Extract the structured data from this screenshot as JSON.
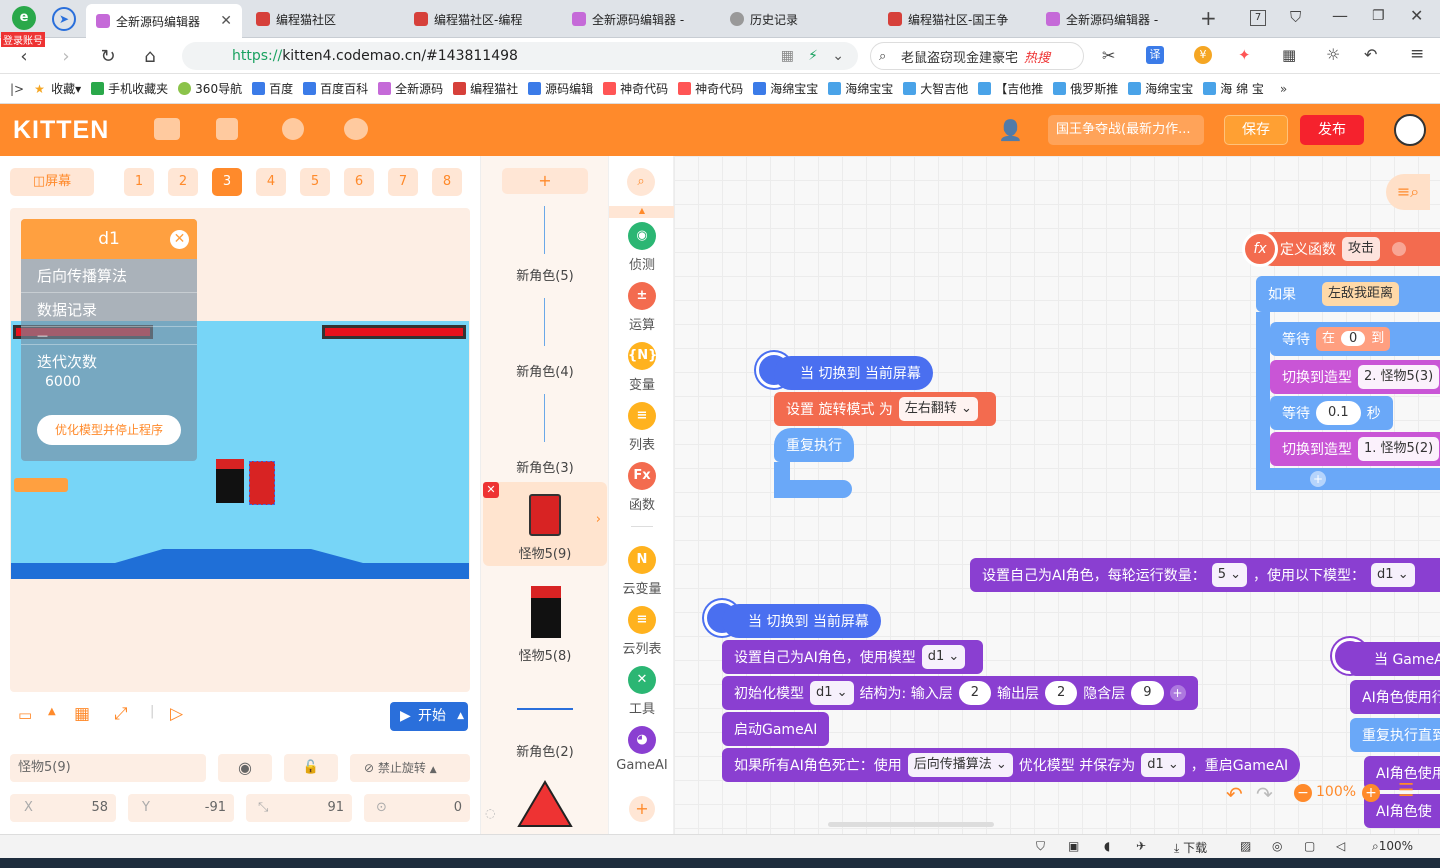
{
  "browser": {
    "login_badge": "登录账号",
    "tabs": [
      {
        "title": "全新源码编辑器",
        "active": true
      },
      {
        "title": "编程猫社区"
      },
      {
        "title": "编程猫社区-编程"
      },
      {
        "title": "全新源码编辑器 -"
      },
      {
        "title": "历史记录"
      },
      {
        "title": "编程猫社区-国王争"
      },
      {
        "title": "全新源码编辑器 -"
      }
    ],
    "url_prefix": "https://",
    "url_rest": "kitten4.codemao.cn/#143811498",
    "search_text": "老鼠盗窃现金建豪宅",
    "search_hot": "热搜",
    "bookmarks": [
      "收藏",
      "手机收藏夹",
      "360导航",
      "百度",
      "百度百科",
      "全新源码",
      "编程猫社",
      "源码编辑",
      "神奇代码",
      "神奇代码",
      "海绵宝宝",
      "海绵宝宝",
      "大智吉他",
      "【吉他推",
      "俄罗斯推",
      "海绵宝宝",
      "海 绵 宝"
    ]
  },
  "kitten": {
    "logo": "KITTEN",
    "project_name": "国王争夺战(最新力作...",
    "save_label": "保存",
    "publish_label": "发布"
  },
  "screens": {
    "screen_label": "屏幕",
    "tabs": [
      "1",
      "2",
      "3",
      "4",
      "5",
      "6",
      "7",
      "8"
    ],
    "active": "3"
  },
  "dialog": {
    "title": "d1",
    "items": [
      "后向传播算法",
      "数据记录",
      "—",
      "迭代次数"
    ],
    "value": "6000",
    "button": "优化模型并停止程序"
  },
  "stage_controls": {
    "start_label": "开始"
  },
  "sprite_props": {
    "name": "怪物5(9)",
    "rotation_label": "禁止旋转",
    "x_label": "X",
    "x_value": "58",
    "y_label": "Y",
    "y_value": "-91",
    "size_value": "91",
    "direction_value": "0"
  },
  "sprites": [
    {
      "name": "新角色(5)"
    },
    {
      "name": "新角色(4)"
    },
    {
      "name": "新角色(3)"
    },
    {
      "name": "怪物5(9)",
      "active": true
    },
    {
      "name": "怪物5(8)"
    },
    {
      "name": "新角色(2)"
    }
  ],
  "categories": [
    {
      "label": "侦测",
      "color": "#2bb673",
      "glyph": "◉"
    },
    {
      "label": "运算",
      "color": "#f36b4f",
      "glyph": "±"
    },
    {
      "label": "变量",
      "color": "#ffb21e",
      "glyph": "{N}"
    },
    {
      "label": "列表",
      "color": "#ffb21e",
      "glyph": "≡"
    },
    {
      "label": "函数",
      "color": "#f36b4f",
      "glyph": "Fx"
    },
    {
      "label": "云变量",
      "color": "#ffb21e",
      "glyph": "N"
    },
    {
      "label": "云列表",
      "color": "#ffb21e",
      "glyph": "≡"
    },
    {
      "label": "工具",
      "color": "#2bb673",
      "glyph": "✕"
    },
    {
      "label": "GameAI",
      "color": "#8a3fd1",
      "glyph": "◕"
    }
  ],
  "blocks": {
    "hat1": "当 切换到 当前屏幕",
    "set_rotate": "设置 旋转模式 为",
    "rotate_mode": "左右翻转",
    "repeat": "重复执行",
    "ai_role": "设置自己为AI角色，每轮运行数量：",
    "ai_count": "5",
    "ai_use_model": "，使用以下模型：",
    "ai_model": "d1",
    "hat2": "当 切换到 当前屏幕",
    "set_ai": "设置自己为AI角色，使用模型",
    "set_ai_model": "d1",
    "init_model": "初始化模型",
    "init_model_name": "d1",
    "structure": "结构为: 输入层",
    "in_layer": "2",
    "out_label": "输出层",
    "out_layer": "2",
    "hidden_label": "隐含层",
    "hidden_layer": "9",
    "start_ai": "启动GameAI",
    "if_dead": "如果所有AI角色死亡：使用",
    "algo": "后向传播算法",
    "optimize": "优化模型 并保存为",
    "save_model": "d1",
    "restart": "，重启GameAI",
    "func_def": "定义函数",
    "func_name": "攻击",
    "if_label": "如果",
    "enemy_dist": "左敌我距离",
    "wait": "等待",
    "in": "在",
    "wait_from": "0",
    "to": "到",
    "switch_costume": "切换到造型",
    "costume1": "2. 怪物5(3)",
    "wait2": "等待",
    "wait_sec": "0.1",
    "sec": "秒",
    "costume2": "1. 怪物5(2)",
    "hat3": "当 GameAI",
    "ai_using": "AI角色使用行",
    "repeat_until": "重复执行直到",
    "ai_use2": "AI角色使用",
    "ai_use3": "AI角色使"
  },
  "workspace": {
    "zoom": "100%"
  },
  "statusbar": {
    "download": "下载",
    "zoom": "100%"
  }
}
